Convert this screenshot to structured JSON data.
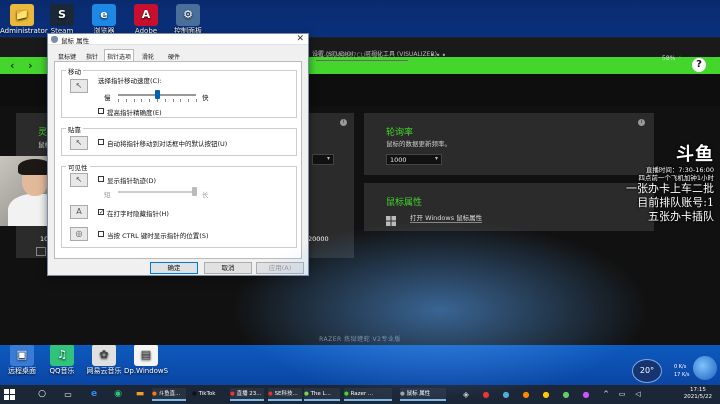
{
  "desktop": {
    "icons_top": [
      {
        "label": "Administrator",
        "icon": "user-folder-icon",
        "color": "#e8b93a",
        "glyph": "📁"
      },
      {
        "label": "Steam",
        "icon": "steam-icon",
        "color": "#1b2838",
        "glyph": "S"
      },
      {
        "label": "浏览器",
        "icon": "ie-icon",
        "color": "#1e88e5",
        "glyph": "e"
      },
      {
        "label": "Adobe",
        "icon": "adobe-icon",
        "color": "#c8102e",
        "glyph": "A"
      },
      {
        "label": "控制面板",
        "icon": "control-panel-icon",
        "color": "#4a6f9a",
        "glyph": "⚙"
      }
    ],
    "icons_bottom": [
      {
        "label": "远程桌面",
        "icon": "remote-desktop-icon",
        "color": "#3a7bd5",
        "glyph": "▣"
      },
      {
        "label": "QQ音乐",
        "icon": "qq-music-icon",
        "color": "#31c27c",
        "glyph": "♫"
      },
      {
        "label": "网易云音乐",
        "icon": "cloud-music-icon",
        "color": "#e0e0e0",
        "glyph": "✿"
      },
      {
        "label": "Dp.WindowS",
        "icon": "document-icon",
        "color": "#f5f5f5",
        "glyph": "▤"
      }
    ]
  },
  "razer": {
    "nav_items": [
      "设置 (STUDIO)",
      "可视化工具 (VISUALIZER)"
    ],
    "device_name": "PC-20200807CUIR-De...",
    "battery": "58%",
    "panels": {
      "left": {
        "title": "灵敏度",
        "desc": "鼠标",
        "value_left": "10",
        "value_right": "20000"
      },
      "middle": {
        "select": "▾"
      },
      "polling": {
        "title": "轮询率",
        "desc": "鼠标的数据更新频率。",
        "select_value": "1000"
      },
      "mouse_props": {
        "title": "鼠标属性",
        "link": "打开 Windows 鼠标属性"
      }
    },
    "footer": "RAZER 炼狱蝰蛇 V2专业版"
  },
  "dialog": {
    "title": "鼠标 属性",
    "tabs": [
      "鼠标键",
      "指针",
      "指针选项",
      "滑轮",
      "硬件"
    ],
    "active_tab": 2,
    "motion": {
      "group_title": "移动",
      "speed_label": "选择指针移动速度(C):",
      "slow": "慢",
      "fast": "快",
      "speed_level": 0.5,
      "precision": "提高指针精确度(E)",
      "precision_checked": false
    },
    "snap": {
      "group_title": "贴靠",
      "label": "自动将指针移动到对话框中的默认按钮(U)",
      "checked": false
    },
    "visibility": {
      "group_title": "可见性",
      "trails": "显示指针轨迹(D)",
      "trails_checked": false,
      "short": "短",
      "long": "长",
      "trail_level": 1.0,
      "hide_typing": "在打字时隐藏指针(H)",
      "hide_typing_checked": true,
      "ctrl_show": "当按 CTRL 键时显示指针的位置(S)",
      "ctrl_checked": false
    },
    "buttons": {
      "ok": "确定",
      "cancel": "取消",
      "apply": "应用(A)"
    }
  },
  "stream": {
    "logo": "斗鱼",
    "live_time": "直播时间：7:30-16:00",
    "line2": "四点前一个飞机加钟1小时",
    "line3": "一张办卡上车二批",
    "line4": "目前排队账号:1",
    "line5": "五张办卡插队"
  },
  "taskbar": {
    "items": [
      {
        "label": "斗鱼直...",
        "icon": "douyu-icon",
        "app": true
      },
      {
        "label": "TikTok",
        "icon": "tiktok-icon",
        "app": false
      },
      {
        "label": "直播 23...",
        "icon": "broadcast-icon",
        "app": true
      },
      {
        "label": "SE科技...",
        "icon": "se-icon",
        "app": true
      },
      {
        "label": "The L...",
        "icon": "game-icon",
        "app": true
      },
      {
        "label": "Razer ...",
        "icon": "razer-icon",
        "app": true
      },
      {
        "label": "鼠标 属性",
        "icon": "mouse-icon",
        "app": true
      }
    ],
    "time": "17:15",
    "date": "2021/5/22",
    "weather": "20°",
    "net_up": "0 K/s",
    "net_down": "17 K/s"
  }
}
